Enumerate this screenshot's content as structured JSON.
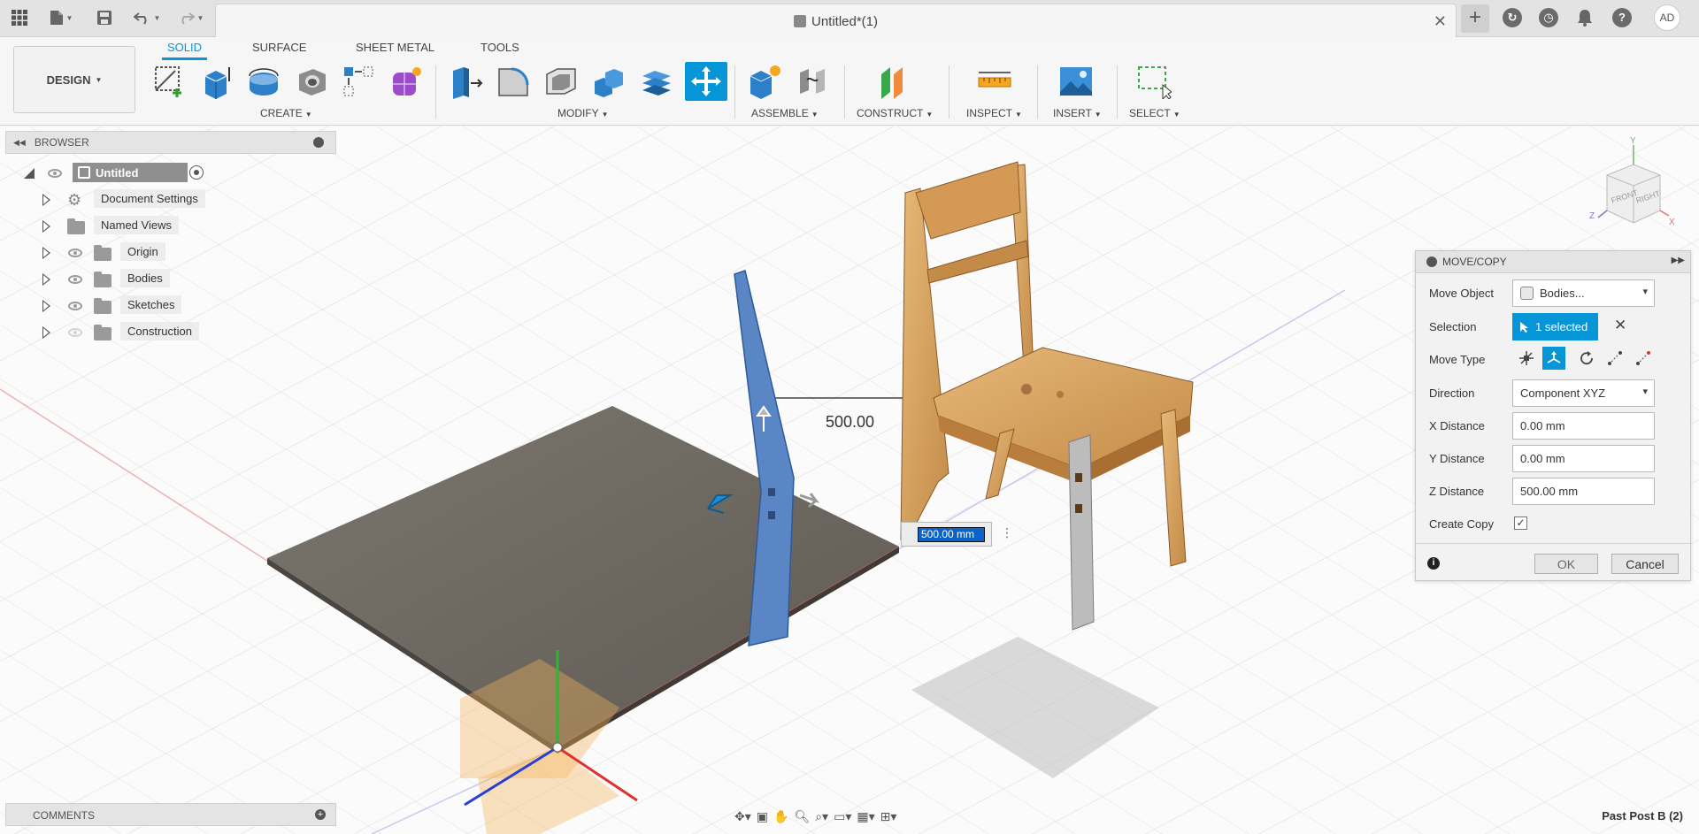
{
  "titlebar": {
    "document_title": "Untitled*(1)",
    "avatar_initials": "AD"
  },
  "toolbar": {
    "workspace": "DESIGN",
    "tabs": [
      {
        "label": "SOLID",
        "active": true
      },
      {
        "label": "SURFACE",
        "active": false
      },
      {
        "label": "SHEET METAL",
        "active": false
      },
      {
        "label": "TOOLS",
        "active": false
      }
    ],
    "groups": {
      "create": "CREATE",
      "modify": "MODIFY",
      "assemble": "ASSEMBLE",
      "construct": "CONSTRUCT",
      "inspect": "INSPECT",
      "insert": "INSERT",
      "select": "SELECT"
    }
  },
  "browser": {
    "title": "BROWSER",
    "root": "Untitled",
    "items": [
      {
        "label": "Document Settings",
        "icon": "gear-icon"
      },
      {
        "label": "Named Views",
        "icon": "folder-icon"
      },
      {
        "label": "Origin",
        "icon": "folder-icon"
      },
      {
        "label": "Bodies",
        "icon": "folder-icon"
      },
      {
        "label": "Sketches",
        "icon": "folder-icon"
      },
      {
        "label": "Construction",
        "icon": "folder-icon"
      }
    ]
  },
  "move_copy": {
    "title": "MOVE/COPY",
    "fields": {
      "move_object_label": "Move Object",
      "move_object_value": "Bodies...",
      "selection_label": "Selection",
      "selection_value": "1 selected",
      "move_type_label": "Move Type",
      "direction_label": "Direction",
      "direction_value": "Component XYZ",
      "x_label": "X Distance",
      "x_value": "0.00 mm",
      "y_label": "Y Distance",
      "y_value": "0.00 mm",
      "z_label": "Z Distance",
      "z_value": "500.00 mm",
      "create_copy_label": "Create Copy",
      "create_copy_checked": true
    },
    "ok_label": "OK",
    "cancel_label": "Cancel"
  },
  "viewport": {
    "dimension_label": "500.00",
    "dimension_input": "500.00 mm"
  },
  "viewcube": {
    "front": "FRONT",
    "right": "RIGHT",
    "axis_x": "X",
    "axis_y": "Y",
    "axis_z": "Z"
  },
  "comments": {
    "title": "COMMENTS"
  },
  "status": {
    "selection_info": "Past Post B (2)"
  },
  "colors": {
    "accent": "#0696d7",
    "body_blue": "#5a86c6",
    "wood": "#d8a464",
    "plate": "#6f6a63"
  }
}
